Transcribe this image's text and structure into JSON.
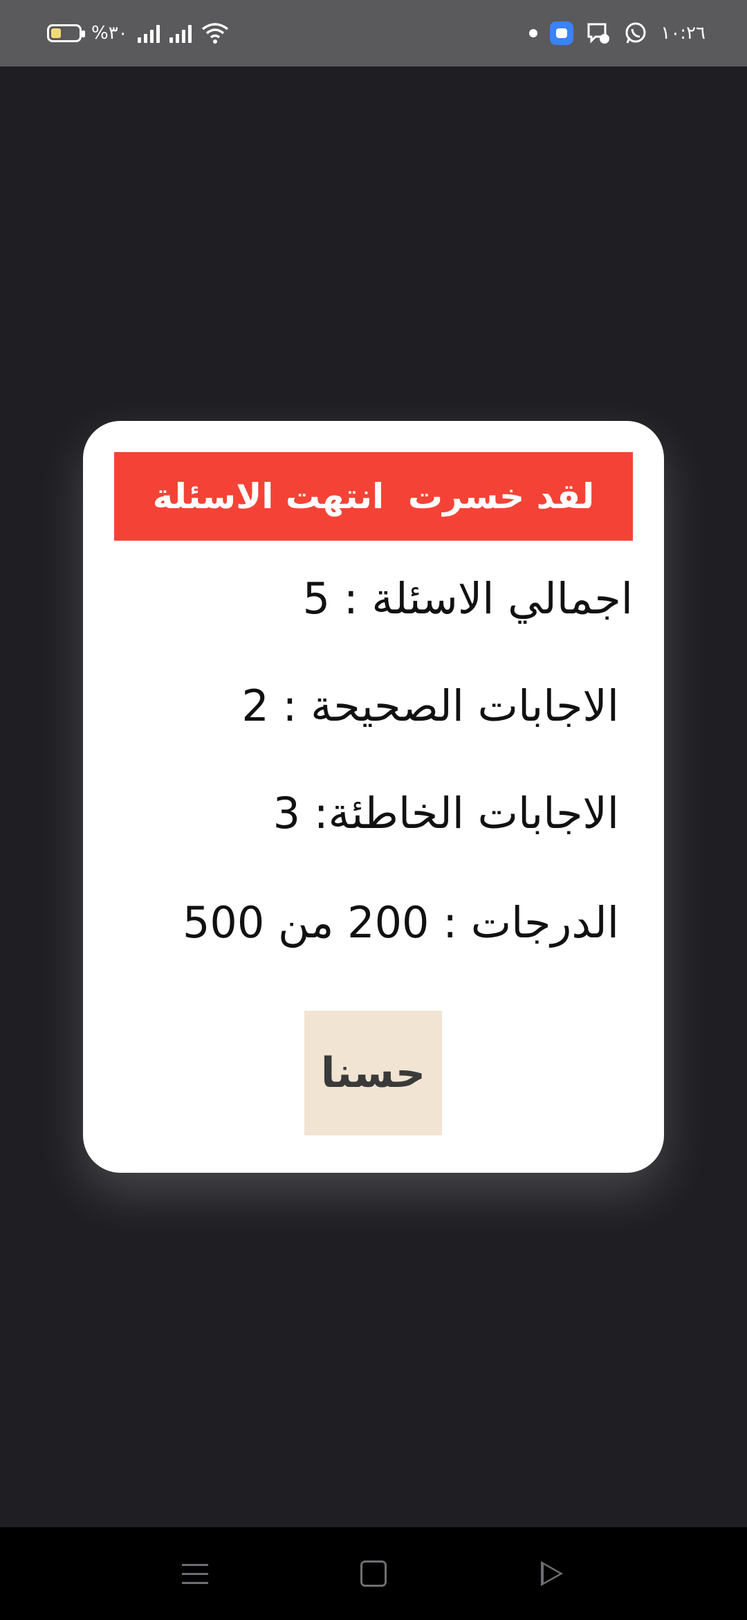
{
  "status_bar": {
    "battery_text": "%٣٠",
    "time": "١٠:٢٦",
    "icons": [
      "battery-icon",
      "signal-icon",
      "signal-icon",
      "wifi-icon",
      "notification-dot-icon",
      "app-icon",
      "messenger-icon",
      "whatsapp-icon"
    ]
  },
  "dialog": {
    "header": "لقد خسرت  انتهت الاسئلة",
    "total_questions": "اجمالي الاسئلة : 5",
    "correct_answers": "الاجابات الصحيحة : 2",
    "wrong_answers": "الاجابات الخاطئة: 3",
    "score": "الدرجات : 200 من 500",
    "ok_label": "حسنا"
  },
  "colors": {
    "background": "#1e1e23",
    "header": "#f44336",
    "button": "#f1e4d3"
  },
  "nav_bar": {
    "icons": [
      "menu-icon",
      "home-icon",
      "back-icon"
    ]
  }
}
